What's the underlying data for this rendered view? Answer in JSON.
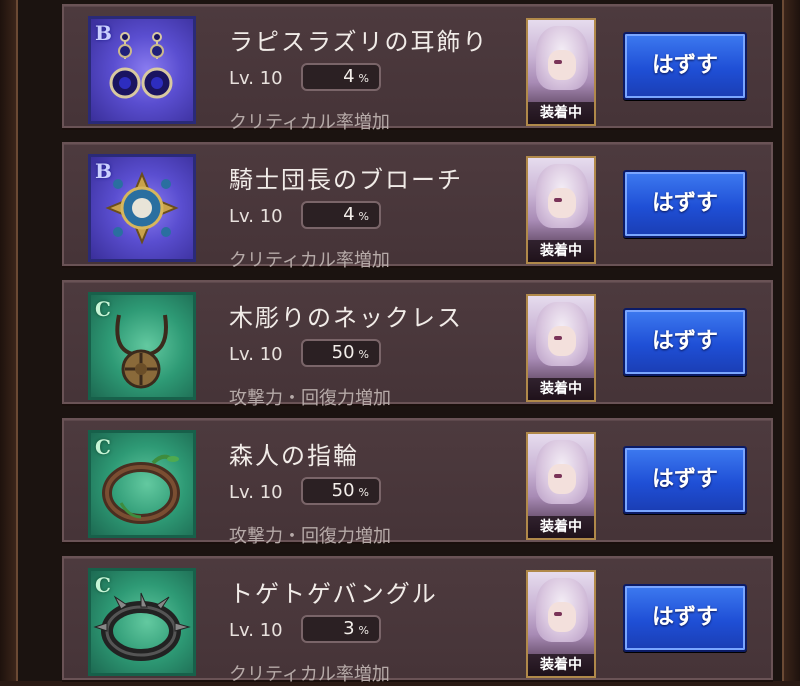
{
  "items": [
    {
      "rank": "B",
      "rank_class": "rank-b",
      "icon": "earrings-icon",
      "name": "ラピスラズリの耳飾り",
      "level": "Lv. 10",
      "percent": "4",
      "unit": "%",
      "effect": "クリティカル率増加",
      "status": "装着中",
      "button": "はずす"
    },
    {
      "rank": "B",
      "rank_class": "rank-b",
      "icon": "brooch-icon",
      "name": "騎士団長のブローチ",
      "level": "Lv. 10",
      "percent": "4",
      "unit": "%",
      "effect": "クリティカル率増加",
      "status": "装着中",
      "button": "はずす"
    },
    {
      "rank": "C",
      "rank_class": "rank-c",
      "icon": "necklace-icon",
      "name": "木彫りのネックレス",
      "level": "Lv. 10",
      "percent": "50",
      "unit": "%",
      "effect": "攻撃力・回復力増加",
      "status": "装着中",
      "button": "はずす"
    },
    {
      "rank": "C",
      "rank_class": "rank-c",
      "icon": "ring-icon",
      "name": "森人の指輪",
      "level": "Lv. 10",
      "percent": "50",
      "unit": "%",
      "effect": "攻撃力・回復力増加",
      "status": "装着中",
      "button": "はずす"
    },
    {
      "rank": "C",
      "rank_class": "rank-c",
      "icon": "bangle-icon",
      "name": "トゲトゲバングル",
      "level": "Lv. 10",
      "percent": "3",
      "unit": "%",
      "effect": "クリティカル率増加",
      "status": "装着中",
      "button": "はずす"
    }
  ]
}
